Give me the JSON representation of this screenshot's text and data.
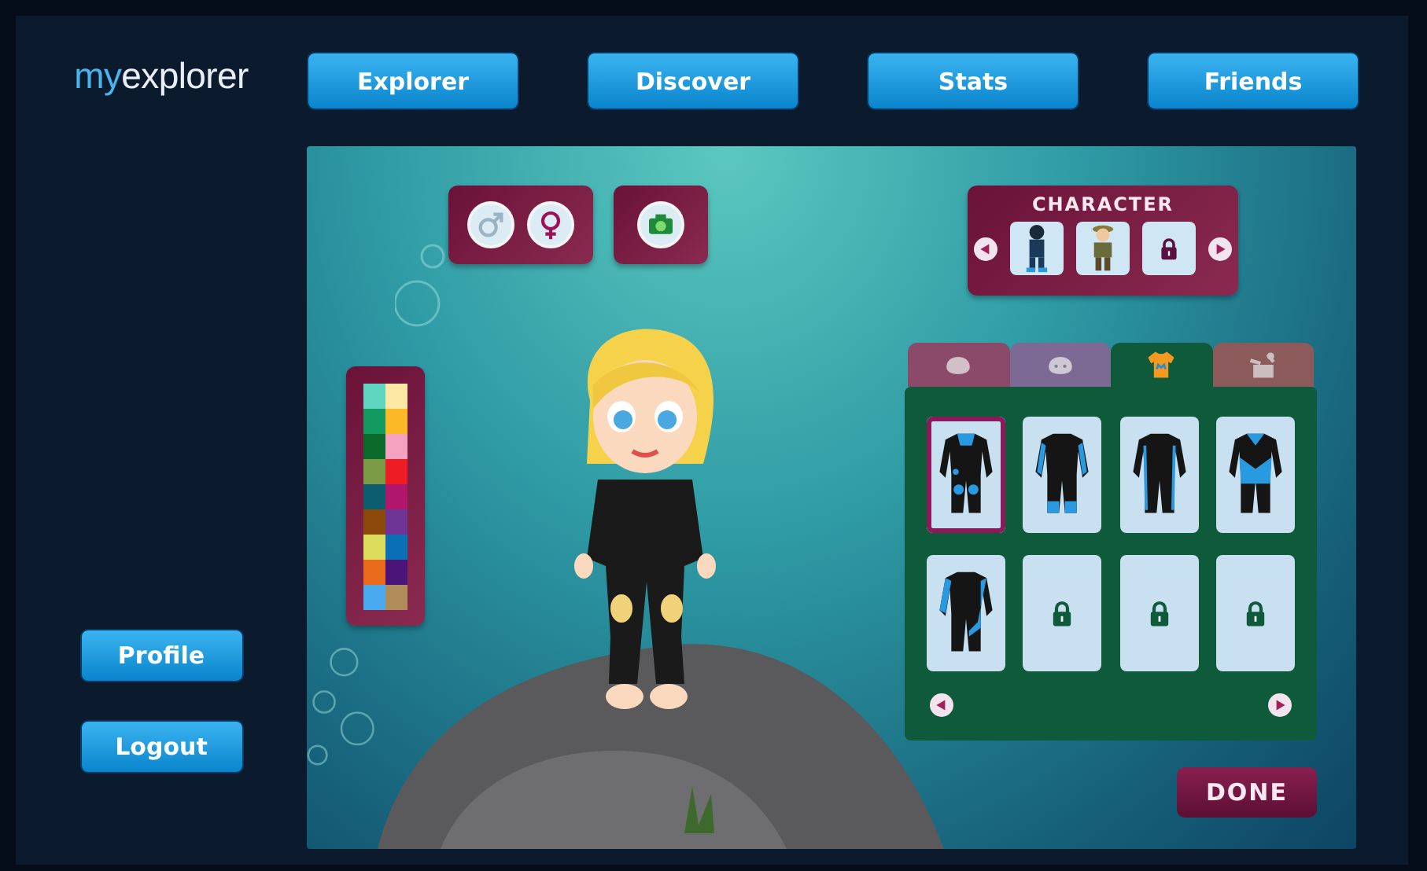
{
  "logo": {
    "prefix": "my",
    "name": "explorer"
  },
  "nav": [
    "Explorer",
    "Discover",
    "Stats",
    "Friends"
  ],
  "side_buttons": [
    "Profile",
    "Logout"
  ],
  "gender_buttons": [
    {
      "kind": "male",
      "selected": false
    },
    {
      "kind": "female",
      "selected": true
    }
  ],
  "character_picker": {
    "title": "CHARACTER",
    "options": [
      {
        "kind": "diver"
      },
      {
        "kind": "safari"
      },
      {
        "kind": "locked"
      }
    ]
  },
  "palette": [
    {
      "color": "#5fd6c0"
    },
    {
      "color": "#fde7a4"
    },
    {
      "color": "#139a60"
    },
    {
      "color": "#fbb928"
    },
    {
      "color": "#0a6a2a"
    },
    {
      "color": "#f5a1c0"
    },
    {
      "color": "#7a9a46"
    },
    {
      "color": "#ee1c24"
    },
    {
      "color": "#0c5d6e"
    },
    {
      "color": "#b0176c"
    },
    {
      "color": "#8c4a0a"
    },
    {
      "color": "#6d3496"
    },
    {
      "color": "#dcdc5c"
    },
    {
      "color": "#0a6fb4"
    },
    {
      "color": "#ea6a1c"
    },
    {
      "color": "#4a1478"
    },
    {
      "color": "#4aaaf0"
    },
    {
      "color": "#b08c5a"
    }
  ],
  "wardrobe": {
    "tabs": [
      {
        "kind": "hair",
        "selected": false,
        "color": "#8c4a6a"
      },
      {
        "kind": "face",
        "selected": false,
        "color": "#7c6a94"
      },
      {
        "kind": "clothes",
        "selected": true,
        "color": "#0e5a3a"
      },
      {
        "kind": "accessories",
        "selected": false,
        "color": "#8c5a5a"
      }
    ],
    "items": [
      {
        "kind": "pads",
        "selected": true
      },
      {
        "kind": "arms",
        "selected": false
      },
      {
        "kind": "sides",
        "selected": false
      },
      {
        "kind": "chevron",
        "selected": false
      },
      {
        "kind": "diagonal",
        "selected": false
      },
      {
        "kind": "locked",
        "selected": false
      },
      {
        "kind": "locked",
        "selected": false
      },
      {
        "kind": "locked",
        "selected": false
      }
    ]
  },
  "done": "DONE"
}
